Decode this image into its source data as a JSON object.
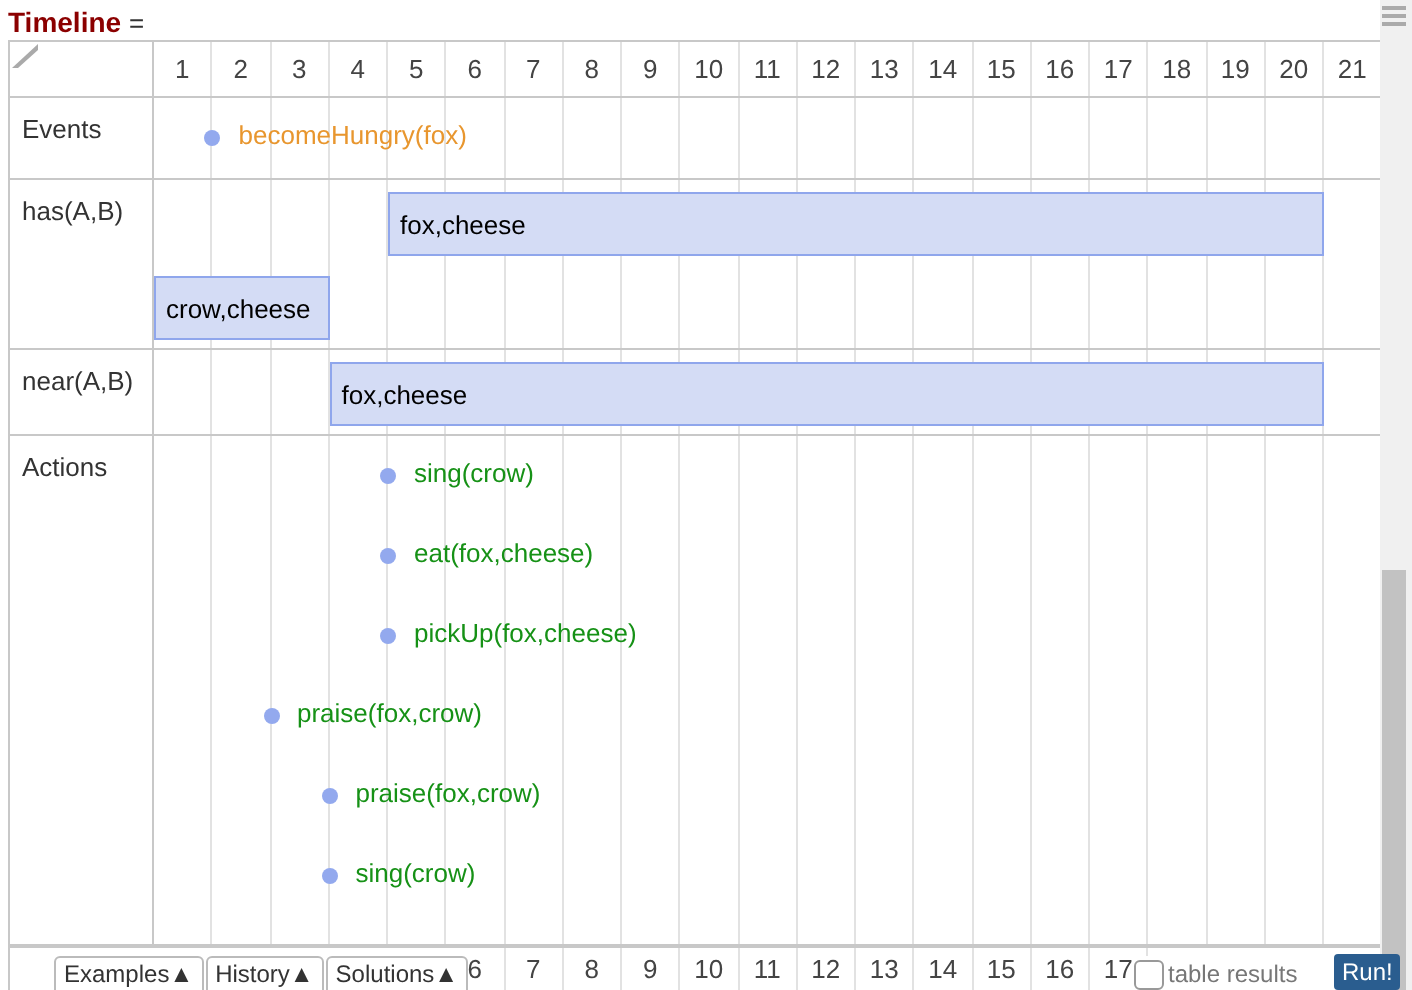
{
  "title": {
    "name": "Timeline",
    "suffix": "="
  },
  "time_axis": [
    "1",
    "2",
    "3",
    "4",
    "5",
    "6",
    "7",
    "8",
    "9",
    "10",
    "11",
    "12",
    "13",
    "14",
    "15",
    "16",
    "17",
    "18",
    "19",
    "20",
    "21"
  ],
  "rows": [
    {
      "label": "Events",
      "lanes": [
        {
          "cells": [
            {
              "kind": "point",
              "text": "becomeHungry(fox)",
              "color": "#e8962e"
            }
          ]
        }
      ]
    },
    {
      "label": "has(A,B)",
      "lanes": [
        {
          "cells": [
            {
              "kind": "blank"
            },
            {
              "kind": "blank"
            },
            {
              "kind": "blank"
            },
            {
              "kind": "blank"
            },
            {
              "kind": "bar_start",
              "text": "fox,cheese"
            },
            {
              "kind": "bar"
            },
            {
              "kind": "bar"
            },
            {
              "kind": "bar"
            },
            {
              "kind": "bar"
            },
            {
              "kind": "bar"
            },
            {
              "kind": "bar"
            },
            {
              "kind": "bar"
            },
            {
              "kind": "bar"
            },
            {
              "kind": "bar"
            },
            {
              "kind": "bar"
            },
            {
              "kind": "bar"
            },
            {
              "kind": "bar"
            },
            {
              "kind": "bar"
            },
            {
              "kind": "bar"
            },
            {
              "kind": "bar"
            }
          ]
        },
        {
          "cells": [
            {
              "kind": "bar_start",
              "text": "crow,cheese"
            },
            {
              "kind": "bar"
            },
            {
              "kind": "bar"
            }
          ]
        }
      ]
    },
    {
      "label": "near(A,B)",
      "lanes": [
        {
          "cells": [
            {
              "kind": "blank"
            },
            {
              "kind": "blank"
            },
            {
              "kind": "blank"
            },
            {
              "kind": "bar_start",
              "text": "fox,cheese"
            },
            {
              "kind": "bar"
            },
            {
              "kind": "bar"
            },
            {
              "kind": "bar"
            },
            {
              "kind": "bar"
            },
            {
              "kind": "bar"
            },
            {
              "kind": "bar"
            },
            {
              "kind": "bar"
            },
            {
              "kind": "bar"
            },
            {
              "kind": "bar"
            },
            {
              "kind": "bar"
            },
            {
              "kind": "bar"
            },
            {
              "kind": "bar"
            },
            {
              "kind": "bar"
            },
            {
              "kind": "bar"
            },
            {
              "kind": "bar"
            },
            {
              "kind": "bar"
            }
          ]
        }
      ]
    },
    {
      "label": "Actions",
      "lanes": [
        {
          "cells": [
            {
              "kind": "blank"
            },
            {
              "kind": "blank"
            },
            {
              "kind": "blank"
            },
            {
              "kind": "point",
              "text": "sing(crow)",
              "color": "#169116"
            }
          ]
        },
        {
          "cells": [
            {
              "kind": "blank"
            },
            {
              "kind": "blank"
            },
            {
              "kind": "blank"
            },
            {
              "kind": "point",
              "text": "eat(fox,cheese)",
              "color": "#169116"
            }
          ]
        },
        {
          "cells": [
            {
              "kind": "blank"
            },
            {
              "kind": "blank"
            },
            {
              "kind": "blank"
            },
            {
              "kind": "point",
              "text": "pickUp(fox,cheese)",
              "color": "#169116"
            }
          ]
        },
        {
          "cells": [
            {
              "kind": "blank"
            },
            {
              "kind": "point",
              "text": "praise(fox,crow)",
              "color": "#169116"
            }
          ]
        },
        {
          "cells": [
            {
              "kind": "blank"
            },
            {
              "kind": "blank"
            },
            {
              "kind": "point",
              "text": "praise(fox,crow)",
              "color": "#169116"
            }
          ]
        },
        {
          "cells": [
            {
              "kind": "blank"
            },
            {
              "kind": "blank"
            },
            {
              "kind": "point",
              "text": "sing(crow)",
              "color": "#169116"
            }
          ]
        }
      ]
    }
  ],
  "bottom_axis": [
    "6",
    "7",
    "8",
    "9",
    "10",
    "11",
    "12",
    "13",
    "14",
    "15",
    "16",
    "17"
  ],
  "toolbar": {
    "menus": [
      "Examples▲",
      "History▲",
      "Solutions▲"
    ],
    "table_results": {
      "label": "table results",
      "checked": false
    },
    "run_button": "Run!"
  }
}
